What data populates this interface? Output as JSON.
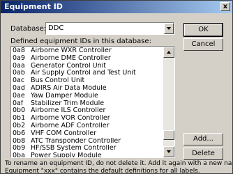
{
  "window": {
    "title": "Equipment ID",
    "close_glyph": "x"
  },
  "database": {
    "label": "Database:",
    "value": "DDC"
  },
  "list": {
    "label": "Defined equipment IDs in this database:",
    "rows": [
      {
        "code": "0a8",
        "name": "Airborne WXR Controller"
      },
      {
        "code": "0a9",
        "name": "Airborne DME Controller"
      },
      {
        "code": "0aa",
        "name": "Generator Control Unit"
      },
      {
        "code": "0ab",
        "name": "Air Supply Control and Test Unit"
      },
      {
        "code": "0ac",
        "name": "Bus Control Unit"
      },
      {
        "code": "0ad",
        "name": "ADIRS Air Data Module"
      },
      {
        "code": "0ae",
        "name": "Yaw Damper Module"
      },
      {
        "code": "0af",
        "name": "Stabilizer Trim Module"
      },
      {
        "code": "0b0",
        "name": "Airborne ILS Controller"
      },
      {
        "code": "0b1",
        "name": "Airborne VOR Controller"
      },
      {
        "code": "0b2",
        "name": "Airborne ADF Controller"
      },
      {
        "code": "0b6",
        "name": "VHF COM Controller"
      },
      {
        "code": "0b8",
        "name": "ATC Transponder Controller"
      },
      {
        "code": "0b9",
        "name": "HF/SSB System Controller"
      },
      {
        "code": "0ba",
        "name": "Power Supply Module"
      }
    ]
  },
  "buttons": {
    "ok": "OK",
    "cancel": "Cancel",
    "add": "Add...",
    "delete": "Delete"
  },
  "footer": {
    "line1": "To rename an equipment ID, do not delete it.  Add it again with a new name.",
    "line2": "Equipment \"xxx\" contains the default definitions for all labels."
  }
}
